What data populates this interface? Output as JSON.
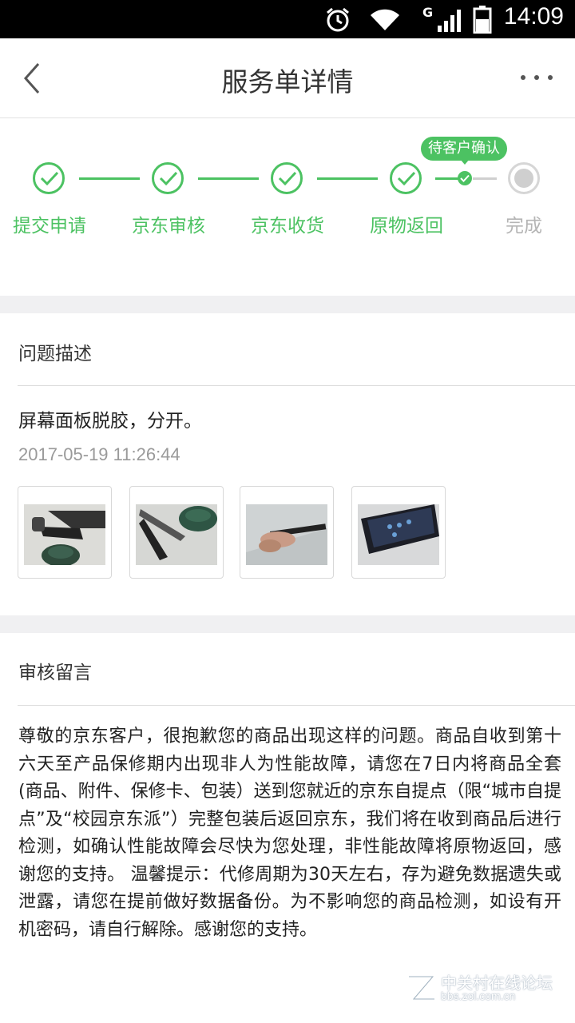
{
  "status_bar": {
    "time": "14:09",
    "network": "G",
    "icons": [
      "alarm-icon",
      "wifi-icon",
      "signal-icon",
      "battery-icon"
    ]
  },
  "nav": {
    "title": "服务单详情",
    "back_icon": "chevron-left-icon",
    "more_icon": "more-dots-icon"
  },
  "progress": {
    "steps": [
      {
        "label": "提交申请",
        "state": "done"
      },
      {
        "label": "京东审核",
        "state": "done"
      },
      {
        "label": "京东收货",
        "state": "done"
      },
      {
        "label": "原物返回",
        "state": "done"
      },
      {
        "label": "完成",
        "state": "pending"
      }
    ],
    "current_status": "待客户确认",
    "accent_color": "#4cc262",
    "inactive_color": "#cfcfcf"
  },
  "problem": {
    "title": "问题描述",
    "text": "屏幕面板脱胶，分开。",
    "time": "2017-05-19 11:26:44",
    "photos": [
      "photo-1",
      "photo-2",
      "photo-3",
      "photo-4"
    ]
  },
  "review": {
    "title": "审核留言",
    "text": "尊敬的京东客户，很抱歉您的商品出现这样的问题。商品自收到第十六天至产品保修期内出现非人为性能故障，请您在7日内将商品全套(商品、附件、保修卡、包装）送到您就近的京东自提点（限“城市自提点”及“校园京东派”）完整包装后返回京东，我们将在收到商品后进行检测，如确认性能故障会尽快为您处理，非性能故障将原物返回，感谢您的支持。 温馨提示：代修周期为30天左右，存为避免数据遗失或泄露，请您在提前做好数据备份。为不影响您的商品检测，如设有开机密码，请自行解除。感谢您的支持。"
  },
  "watermark": {
    "cn": "中关村在线论坛",
    "en": "bbs.zol.com.cn"
  }
}
